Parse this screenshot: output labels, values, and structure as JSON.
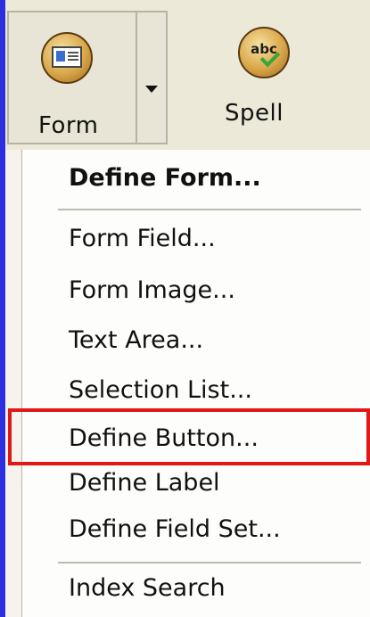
{
  "toolbar": {
    "form_label": "Form",
    "spell_label": "Spell",
    "spell_icon_text": "abc"
  },
  "menu": {
    "items": [
      {
        "label": "Define Form...",
        "bold": true
      },
      {
        "label": "Form Field..."
      },
      {
        "label": "Form Image..."
      },
      {
        "label": "Text Area..."
      },
      {
        "label": "Selection List..."
      },
      {
        "label": "Define Button...",
        "highlighted": true
      },
      {
        "label": "Define Label"
      },
      {
        "label": "Define Field Set..."
      },
      {
        "label": "Index Search"
      }
    ]
  },
  "colors": {
    "background": "#2b2fe0",
    "highlight_border": "#e01818"
  }
}
